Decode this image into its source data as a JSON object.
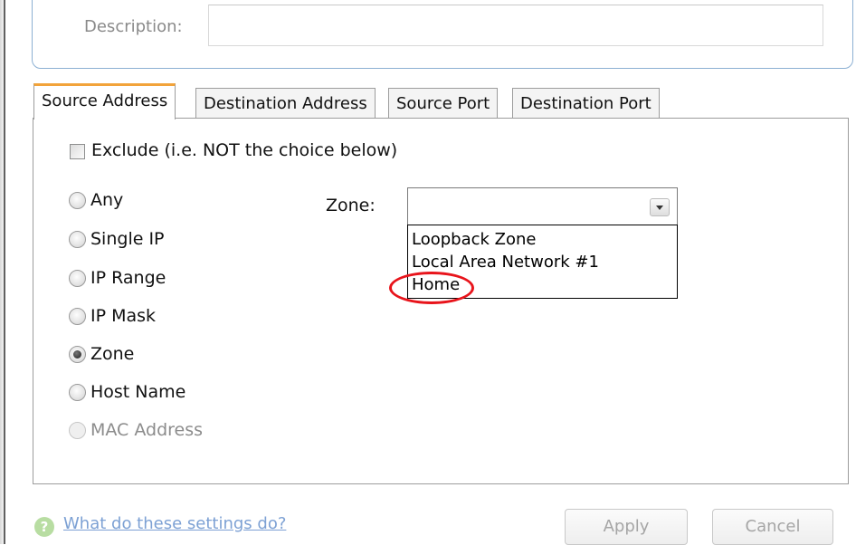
{
  "description": {
    "label": "Description:",
    "value": ""
  },
  "tabs": [
    {
      "label": "Source Address",
      "active": true
    },
    {
      "label": "Destination Address",
      "active": false
    },
    {
      "label": "Source Port",
      "active": false
    },
    {
      "label": "Destination Port",
      "active": false
    }
  ],
  "exclude": {
    "label": "Exclude (i.e. NOT the choice below)",
    "checked": false
  },
  "radios": [
    {
      "label": "Any",
      "selected": false,
      "enabled": true
    },
    {
      "label": "Single IP",
      "selected": false,
      "enabled": true
    },
    {
      "label": "IP Range",
      "selected": false,
      "enabled": true
    },
    {
      "label": "IP Mask",
      "selected": false,
      "enabled": true
    },
    {
      "label": "Zone",
      "selected": true,
      "enabled": true
    },
    {
      "label": "Host Name",
      "selected": false,
      "enabled": true
    },
    {
      "label": "MAC Address",
      "selected": false,
      "enabled": false
    }
  ],
  "zone": {
    "label": "Zone:",
    "value": "",
    "options": [
      "Loopback Zone",
      "Local Area Network #1",
      "Home"
    ]
  },
  "footer": {
    "help_link": "What do these settings do?",
    "apply_label": "Apply",
    "cancel_label": "Cancel"
  },
  "colors": {
    "active_tab_accent": "#f2a33a",
    "highlight_ellipse": "#e8141b",
    "link": "#7da1d4"
  },
  "icons": {
    "help": "help-icon",
    "dropdown": "chevron-down-icon"
  }
}
